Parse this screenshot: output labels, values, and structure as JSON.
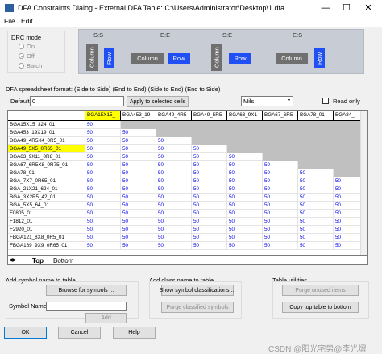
{
  "window": {
    "title": "DFA Constraints Dialog - External DFA Table: C:\\Users\\Administrator\\Desktop\\1.dfa",
    "minimize": "—",
    "maximize": "☐",
    "close": "✕"
  },
  "menu": [
    "File",
    "Edit"
  ],
  "drc_mode": {
    "label": "DRC mode",
    "options": [
      {
        "label": "On",
        "selected": false
      },
      {
        "label": "Off",
        "selected": true
      },
      {
        "label": "Batch",
        "selected": false
      }
    ]
  },
  "diagram": {
    "titles": [
      "S:S",
      "E:E",
      "S:E",
      "E:S"
    ],
    "column": "Column",
    "row": "Row"
  },
  "format_text": "DFA spreadsheet format: (Side to Side) (End to End) (Side to End) (End to Side)",
  "default_label": "Default:",
  "default_value": "0",
  "apply_button": "Apply to selected cells",
  "units": "Mils",
  "read_only_label": "Read only",
  "grid": {
    "columns": [
      "BGA15X15_",
      "BGA453_19",
      "BGA49_4R5",
      "BGA49_5R5",
      "BGA63_9X1",
      "BGA67_6R5",
      "BGA78_01",
      "BGA84_"
    ],
    "selected_column": 0,
    "rows": [
      {
        "name": "BGA15X15_324_01",
        "values": [
          "50"
        ]
      },
      {
        "name": "BGA453_19X19_01",
        "values": [
          "50",
          "50"
        ]
      },
      {
        "name": "BGA49_4R5X4_0R5_01",
        "values": [
          "50",
          "50",
          "50"
        ]
      },
      {
        "name": "BGA49_5X5_0R65_01",
        "values": [
          "50",
          "50",
          "50",
          "50"
        ]
      },
      {
        "name": "BGA63_9X11_0R8_01",
        "values": [
          "50",
          "50",
          "50",
          "50",
          "50"
        ]
      },
      {
        "name": "BGA67_6R5X8_0R75_01",
        "values": [
          "50",
          "50",
          "50",
          "50",
          "50",
          "50"
        ]
      },
      {
        "name": "BGA78_01",
        "values": [
          "50",
          "50",
          "50",
          "50",
          "50",
          "50",
          "50"
        ]
      },
      {
        "name": "BGA_7X7_0R65_01",
        "values": [
          "50",
          "50",
          "50",
          "50",
          "50",
          "50",
          "50",
          "50"
        ]
      },
      {
        "name": "BGA_21X21_624_01",
        "values": [
          "50",
          "50",
          "50",
          "50",
          "50",
          "50",
          "50",
          "50"
        ]
      },
      {
        "name": "BGA_3X2R5_42_01",
        "values": [
          "50",
          "50",
          "50",
          "50",
          "50",
          "50",
          "50",
          "50"
        ]
      },
      {
        "name": "BGA_5X5_64_01",
        "values": [
          "50",
          "50",
          "50",
          "50",
          "50",
          "50",
          "50",
          "50"
        ]
      },
      {
        "name": "F0805_01",
        "values": [
          "50",
          "50",
          "50",
          "50",
          "50",
          "50",
          "50",
          "50"
        ]
      },
      {
        "name": "F1812_01",
        "values": [
          "50",
          "50",
          "50",
          "50",
          "50",
          "50",
          "50",
          "50"
        ]
      },
      {
        "name": "F2920_01",
        "values": [
          "50",
          "50",
          "50",
          "50",
          "50",
          "50",
          "50",
          "50"
        ]
      },
      {
        "name": "FBGA121_8X8_0R5_01",
        "values": [
          "50",
          "50",
          "50",
          "50",
          "50",
          "50",
          "50",
          "50"
        ]
      },
      {
        "name": "FBGA169_9X9_0R65_01",
        "values": [
          "50",
          "50",
          "50",
          "50",
          "50",
          "50",
          "50",
          "50"
        ]
      }
    ],
    "selected_row": 3
  },
  "tabs": [
    "Top",
    "Bottom"
  ],
  "symbol_section": {
    "title": "Add symbol name to table",
    "browse_button": "Browse for symbols ...",
    "symbol_name_label": "Symbol Name:",
    "add_button": "Add"
  },
  "class_section": {
    "title": "Add class name to table",
    "show_button": "Show symbol classifications ...",
    "purge_button": "Purge classified symbols"
  },
  "utilities_section": {
    "title": "Table utilities",
    "purge_unused": "Purge unused items",
    "copy_top": "Copy top table to bottom"
  },
  "footer": {
    "ok": "OK",
    "cancel": "Cancel",
    "help": "Help"
  },
  "watermark": "CSDN @阳光宅男@李光熠"
}
